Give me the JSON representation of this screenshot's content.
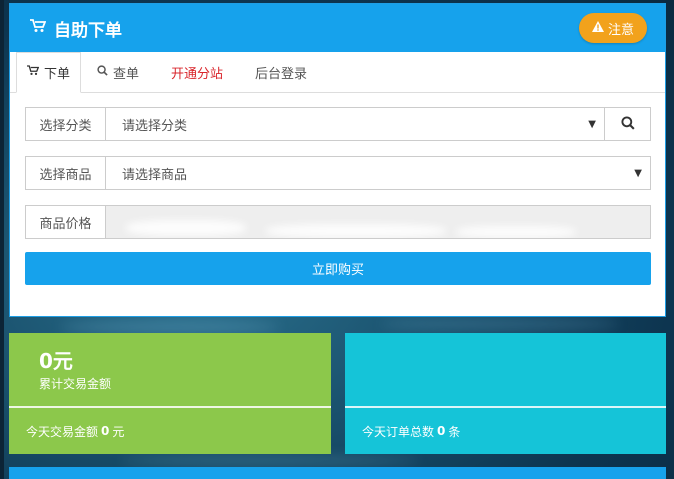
{
  "header": {
    "title": "自助下单",
    "notice_label": "注意",
    "icon": "cart-icon",
    "notice_icon": "warning-icon"
  },
  "tabs": [
    {
      "label": "下单",
      "icon": "cart-icon",
      "active": true
    },
    {
      "label": "查单",
      "icon": "search-icon",
      "active": false
    },
    {
      "label": "开通分站",
      "active": false,
      "color": "#d9262c"
    },
    {
      "label": "后台登录",
      "active": false
    }
  ],
  "form": {
    "category_label": "选择分类",
    "category_value": "请选择分类",
    "product_label": "选择商品",
    "product_value": "请选择商品",
    "price_label": "商品价格",
    "price_value": "",
    "buy_label": "立即购买"
  },
  "stats": {
    "total_amount": "0元",
    "total_amount_label": "累计交易金额",
    "today_amount_prefix": "今天交易金额",
    "today_amount_value": "0",
    "today_amount_unit": "元",
    "today_orders_prefix": "今天订单总数",
    "today_orders_value": "0",
    "today_orders_unit": "条"
  },
  "colors": {
    "primary": "#16a2ec",
    "warning": "#f2a21c",
    "green": "#8cc84b",
    "cyan": "#15c4d8",
    "red": "#d9262c"
  }
}
